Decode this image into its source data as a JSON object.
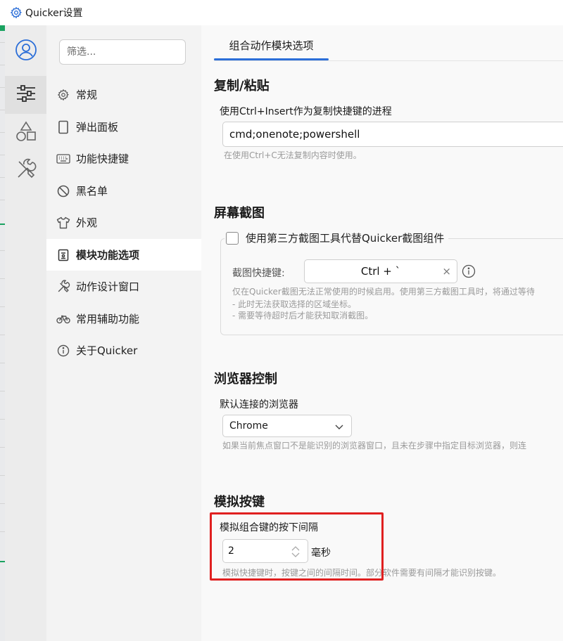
{
  "window": {
    "title": "Quicker设置",
    "icon": "gear-icon"
  },
  "rail": {
    "items": [
      {
        "icon": "user-circle-icon",
        "active": false
      },
      {
        "icon": "sliders-icon",
        "active": true
      },
      {
        "icon": "shapes-icon",
        "active": false
      },
      {
        "icon": "tools-icon",
        "active": false
      }
    ]
  },
  "sidebar": {
    "filter_placeholder": "筛选...",
    "items": [
      {
        "label": "常规",
        "icon": "gear-icon"
      },
      {
        "label": "弹出面板",
        "icon": "panel-icon"
      },
      {
        "label": "功能快捷键",
        "icon": "keyboard-icon"
      },
      {
        "label": "黑名单",
        "icon": "block-icon"
      },
      {
        "label": "外观",
        "icon": "shirt-icon"
      },
      {
        "label": "模块功能选项",
        "icon": "module-icon",
        "active": true
      },
      {
        "label": "动作设计窗口",
        "icon": "design-tools-icon"
      },
      {
        "label": "常用辅助功能",
        "icon": "bicycle-icon"
      },
      {
        "label": "关于Quicker",
        "icon": "info-icon"
      }
    ]
  },
  "main": {
    "tab_label": "组合动作模块选项",
    "copy_paste": {
      "title": "复制/粘贴",
      "field_label": "使用Ctrl+Insert作为复制快捷键的进程",
      "field_value": "cmd;onenote;powershell",
      "hint": "在使用Ctrl+C无法复制内容时使用。"
    },
    "screenshot": {
      "title": "屏幕截图",
      "checkbox_label": "使用第三方截图工具代替Quicker截图组件",
      "checked": false,
      "hotkey_label": "截图快捷键:",
      "hotkey_value": "Ctrl + `",
      "clear_glyph": "×",
      "hint_lines": [
        "仅在Quicker截图无法正常使用的时候启用。使用第三方截图工具时，将通过等待",
        "- 此时无法获取选择的区域坐标。",
        "- 需要等待超时后才能获知取消截图。"
      ]
    },
    "browser": {
      "title": "浏览器控制",
      "field_label": "默认连接的浏览器",
      "selected": "Chrome",
      "hint": "如果当前焦点窗口不是能识别的浏览器窗口，且未在步骤中指定目标浏览器，则连"
    },
    "keys": {
      "title": "模拟按键",
      "field_label": "模拟组合键的按下间隔",
      "value": "2",
      "unit": "毫秒",
      "hint": "模拟快捷键时，按键之间的间隔时间。部分软件需要有间隔才能识别按键。"
    }
  },
  "colors": {
    "accent": "#2b6ed8",
    "highlight": "#e02020",
    "sidebar_bg": "#f3f3f3",
    "rail_bg": "#ececec"
  }
}
